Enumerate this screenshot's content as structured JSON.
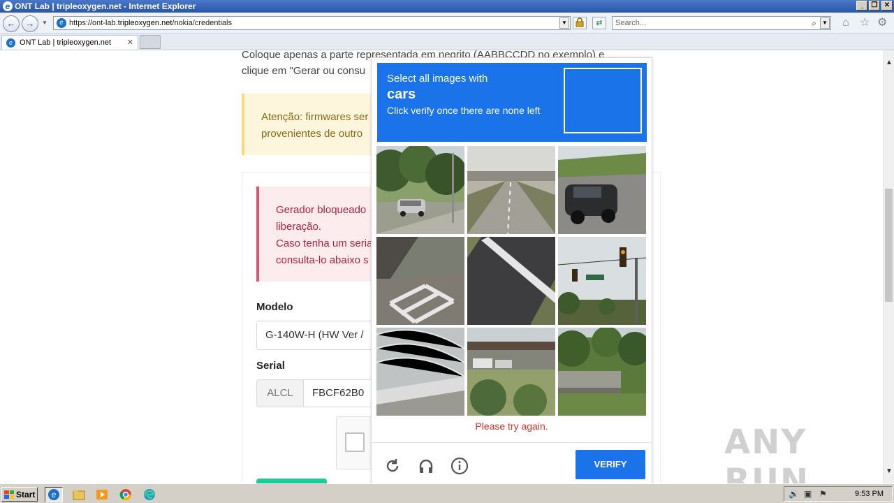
{
  "browser": {
    "window_title": "ONT Lab | tripleoxygen.net - Internet Explorer",
    "url_prefix": "https://ont-lab.",
    "url_host": "tripleoxygen.net",
    "url_path": "/nokia/credentials",
    "search_placeholder": "Search...",
    "tab_title": "ONT Lab | tripleoxygen.net"
  },
  "page": {
    "intro_text": "Coloque apenas a parte representada em negrito (AABBCCDD no exemplo) e clique em \"Gerar ou consu",
    "warning_text_line1": "Atenção: firmwares ser",
    "warning_text_line2": "provenientes de outro",
    "error_line1": "Gerador bloqueado",
    "error_line2": "liberação.",
    "error_line3": "Caso tenha um seria",
    "error_line4": "consulta-lo abaixo s",
    "modelo_label": "Modelo",
    "modelo_value": "G-140W-H (HW Ver /",
    "serial_label": "Serial",
    "serial_prefix": "ALCL",
    "serial_value": "FBCF62B0"
  },
  "hcaptcha": {
    "prompt": "Select all images with",
    "target": "cars",
    "instruction": "Click verify once there are none left",
    "error": "Please try again.",
    "verify_label": "VERIFY",
    "tiles": [
      {
        "name": "tile-trees-car"
      },
      {
        "name": "tile-road-bridge"
      },
      {
        "name": "tile-black-car"
      },
      {
        "name": "tile-crosswalk"
      },
      {
        "name": "tile-road-lane"
      },
      {
        "name": "tile-traffic-light"
      },
      {
        "name": "tile-overpass-noise"
      },
      {
        "name": "tile-bridge-vehicles"
      },
      {
        "name": "tile-bridge-greenery"
      }
    ],
    "colors": {
      "header": "#1a73e8",
      "error": "#d93025",
      "button": "#1a73e8"
    }
  },
  "watermark": "ANY RUN",
  "taskbar": {
    "start_label": "Start",
    "clock": "9:53 PM"
  }
}
